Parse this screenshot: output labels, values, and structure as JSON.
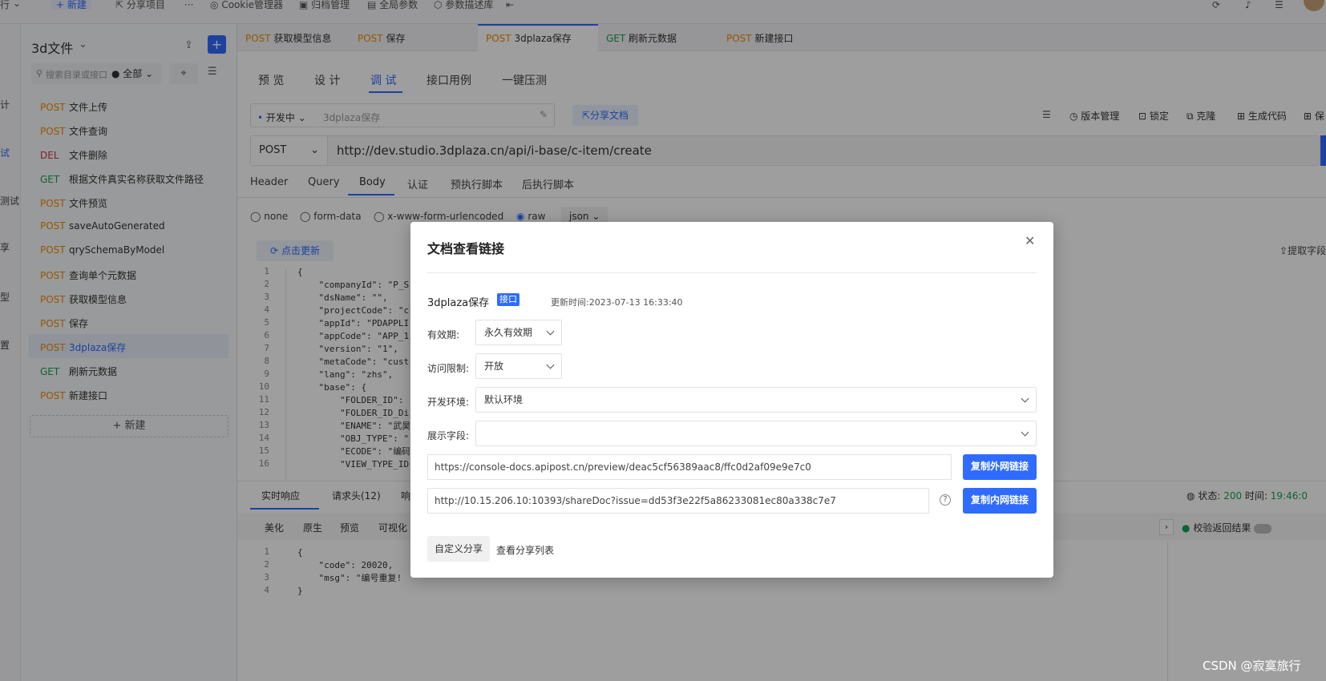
{
  "topbar": {
    "run_partial": "行",
    "new": "+ 新建",
    "share_project": "分享项目",
    "more": "···",
    "cookie": "Cookie管理器",
    "archive": "归档管理",
    "global_params": "全局参数",
    "param_lib": "参数描述库"
  },
  "left_rail": [
    "计",
    "试",
    "测试",
    "享",
    "型",
    "置"
  ],
  "sidebar": {
    "title": "3d文件",
    "search_placeholder": "搜索目录或接口",
    "filter_all": "全部",
    "items": [
      {
        "method": "POST",
        "name": "文件上传"
      },
      {
        "method": "POST",
        "name": "文件查询"
      },
      {
        "method": "DEL",
        "name": "文件删除"
      },
      {
        "method": "GET",
        "name": "根据文件真实名称获取文件路径"
      },
      {
        "method": "POST",
        "name": "文件预览"
      },
      {
        "method": "POST",
        "name": "saveAutoGenerated"
      },
      {
        "method": "POST",
        "name": "qrySchemaByModel"
      },
      {
        "method": "POST",
        "name": "查询单个元数据"
      },
      {
        "method": "POST",
        "name": "获取模型信息"
      },
      {
        "method": "POST",
        "name": "保存"
      },
      {
        "method": "POST",
        "name": "3dplaza保存"
      },
      {
        "method": "GET",
        "name": "刷新元数据"
      },
      {
        "method": "POST",
        "name": "新建接口"
      }
    ],
    "new_button": "+ 新建"
  },
  "tabs": [
    {
      "method": "POST",
      "name": "获取模型信息"
    },
    {
      "method": "POST",
      "name": "保存"
    },
    {
      "method": "POST",
      "name": "3dplaza保存"
    },
    {
      "method": "GET",
      "name": "刷新元数据"
    },
    {
      "method": "POST",
      "name": "新建接口"
    }
  ],
  "subtabs": [
    "预 览",
    "设 计",
    "调 试",
    "接口用例",
    "一键压测"
  ],
  "status_select": "开发中",
  "api_name": "3dplaza保存",
  "share_doc": "分享文档",
  "toolbar_right": [
    "版本管理",
    "锁定",
    "克隆",
    "生成代码",
    "保"
  ],
  "request": {
    "method": "POST",
    "url": "http://dev.studio.3dplaza.cn/api/i-base/c-item/create"
  },
  "req_tabs": [
    "Header",
    "Query",
    "Body",
    "认证",
    "预执行脚本",
    "后执行脚本"
  ],
  "body_types": [
    "none",
    "form-data",
    "x-www-form-urlencoded",
    "raw"
  ],
  "body_format": "json",
  "click_update": "点击更新",
  "extract_fields": "提取字段",
  "code_lines": [
    "{",
    "    \"companyId\": \"P_S",
    "    \"dsName\": \"\",",
    "    \"projectCode\": \"c",
    "    \"appId\": \"PDAPPLIC",
    "    \"appCode\": \"APP_1",
    "    \"version\": \"1\",",
    "    \"metaCode\": \"custo",
    "    \"lang\": \"zhs\",",
    "    \"base\": {",
    "        \"FOLDER_ID\":",
    "        \"FOLDER_ID_Di",
    "        \"ENAME\": \"武昊",
    "        \"OBJ_TYPE\": \"",
    "        \"ECODE\": \"编码",
    "        \"VIEW_TYPE_ID"
  ],
  "response": {
    "tabs": [
      "实时响应",
      "请求头(12)",
      "响"
    ],
    "view_tabs": [
      "美化",
      "原生",
      "预览",
      "可视化"
    ],
    "status_label": "状态:",
    "status_value": "200",
    "time_label": "时间:",
    "time_value": "19:46:0",
    "verify_label": "校验返回结果",
    "code_lines": [
      "{",
      "    \"code\": 20020,",
      "    \"msg\": \"编号重复!",
      "}"
    ]
  },
  "modal": {
    "title": "文档查看链接",
    "api_name": "3dplaza保存",
    "badge": "接口",
    "updated_label": "更新时间:",
    "updated_value": "2023-07-13 16:33:40",
    "validity_label": "有效期:",
    "validity_value": "永久有效期",
    "access_label": "访问限制:",
    "access_value": "开放",
    "env_label": "开发环境:",
    "env_value": "默认环境",
    "fields_label": "展示字段:",
    "fields_value": "",
    "external_url": "https://console-docs.apipost.cn/preview/deac5cf56389aac8/ffc0d2af09e9e7c0",
    "copy_external": "复制外网链接",
    "internal_url": "http://10.15.206.10:10393/shareDoc?issue=dd53f3e22f5a86233081ec80a338c7e7",
    "copy_internal": "复制内网链接",
    "custom_share": "自定义分享",
    "view_share_list": "查看分享列表"
  },
  "watermark": "CSDN @寂寞旅行"
}
